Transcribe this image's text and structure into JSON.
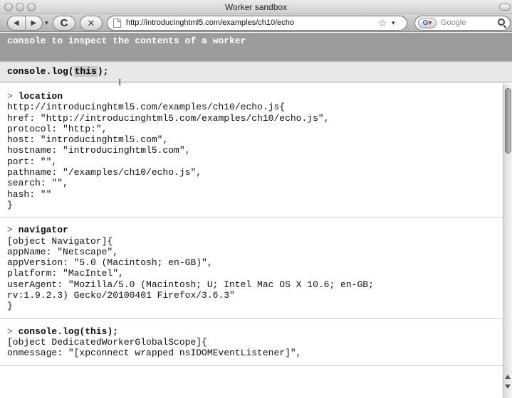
{
  "window": {
    "title": "Worker sandbox"
  },
  "toolbar": {
    "back_icon": "◀",
    "forward_icon": "▶",
    "history_dropdown_icon": "▾",
    "reload_icon": "C",
    "stop_icon": "✕",
    "url": "http://introducinghtml5.com/examples/ch10/echo",
    "bookmark_icon": "☆",
    "url_dropdown_icon": "▾",
    "search_engine": "Google",
    "search_placeholder": ""
  },
  "page": {
    "heading": "console to inspect the contents of a worker",
    "input_prefix": "console.log(",
    "input_selected": "this",
    "input_suffix": ");",
    "output": [
      {
        "prompt": ">",
        "command": "location",
        "lines": [
          "http://introducinghtml5.com/examples/ch10/echo.js{",
          "href: \"http://introducinghtml5.com/examples/ch10/echo.js\",",
          "protocol: \"http:\",",
          "host: \"introducinghtml5.com\",",
          "hostname: \"introducinghtml5.com\",",
          "port: \"\",",
          "pathname: \"/examples/ch10/echo.js\",",
          "search: \"\",",
          "hash: \"\"",
          "}"
        ]
      },
      {
        "prompt": ">",
        "command": "navigator",
        "lines": [
          "[object Navigator]{",
          "appName: \"Netscape\",",
          "appVersion: \"5.0 (Macintosh; en-GB)\",",
          "platform: \"MacIntel\",",
          "userAgent: \"Mozilla/5.0 (Macintosh; U; Intel Mac OS X 10.6; en-GB;",
          "rv:1.9.2.3) Gecko/20100401 Firefox/3.6.3\"",
          "}"
        ]
      },
      {
        "prompt": ">",
        "command": "console.log(this);",
        "lines": [
          "[object DedicatedWorkerGlobalScope]{",
          "onmessage: \"[xpconnect wrapped nsIDOMEventListener]\","
        ]
      }
    ]
  }
}
